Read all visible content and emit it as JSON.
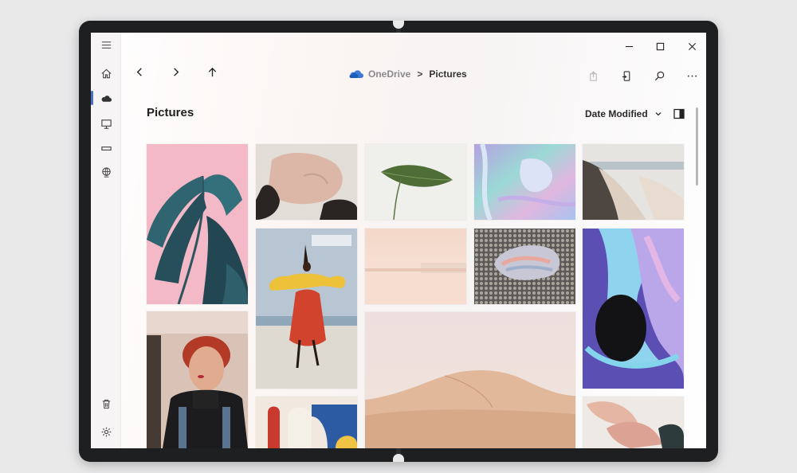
{
  "window": {
    "minimize_label": "Minimize",
    "maximize_label": "Maximize",
    "close_label": "Close"
  },
  "nav": {
    "back_icon": "chevron-left-icon",
    "forward_icon": "chevron-right-icon",
    "up_icon": "arrow-up-icon"
  },
  "breadcrumb": {
    "root": "OneDrive",
    "separator": ">",
    "current": "Pictures"
  },
  "sidebar": {
    "items": [
      {
        "name": "menu",
        "icon": "hamburger-menu-icon"
      },
      {
        "name": "home",
        "icon": "home-icon"
      },
      {
        "name": "onedrive",
        "icon": "cloud-icon",
        "active": true
      },
      {
        "name": "this-pc",
        "icon": "monitor-icon"
      },
      {
        "name": "drive",
        "icon": "drive-icon"
      },
      {
        "name": "network",
        "icon": "network-globe-icon"
      },
      {
        "name": "recycle-bin",
        "icon": "trash-icon"
      },
      {
        "name": "settings",
        "icon": "gear-icon"
      }
    ]
  },
  "toolbar": {
    "share_icon": "share-icon",
    "device_icon": "phone-device-icon",
    "search_icon": "search-icon",
    "more_icon": "more-ellipsis-icon"
  },
  "page": {
    "title": "Pictures",
    "sort_label": "Date Modified"
  },
  "colors": {
    "accent": "#4d71c7",
    "onedrive_blue": "#3c7ad6"
  },
  "photos": [
    {
      "name": "palm-leaf-pink"
    },
    {
      "name": "abstract-paint-beige"
    },
    {
      "name": "green-leaf"
    },
    {
      "name": "holographic-marble"
    },
    {
      "name": "beach-dunes"
    },
    {
      "name": "dancer-yellow-dress"
    },
    {
      "name": "desert-building"
    },
    {
      "name": "mesh-sky"
    },
    {
      "name": "purple-silk-abstract"
    },
    {
      "name": "woman-portrait"
    },
    {
      "name": "desert-mountain"
    },
    {
      "name": "colorful-shapes"
    },
    {
      "name": "peach-leaves"
    }
  ]
}
